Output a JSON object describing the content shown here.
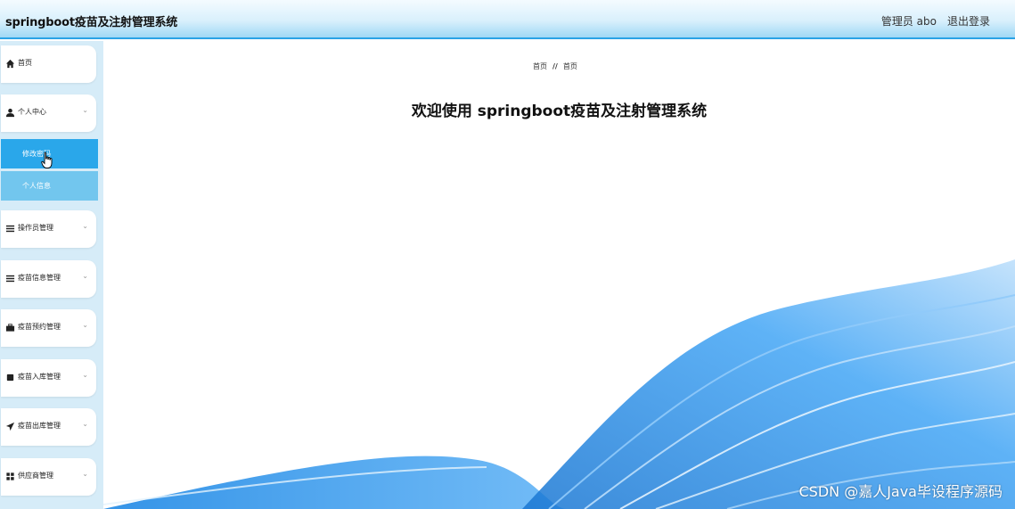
{
  "header": {
    "app_title": "springboot疫苗及注射管理系统",
    "user_info": "管理员 abo",
    "logout_label": "退出登录"
  },
  "sidebar": {
    "home_label": "首页",
    "personal_center_label": "个人中心",
    "change_password_label": "修改密码",
    "personal_info_label": "个人信息",
    "operator_mgmt_label": "操作员管理",
    "vaccine_info_label": "疫苗信息管理",
    "vaccine_appt_label": "疫苗预约管理",
    "vaccine_in_label": "疫苗入库管理",
    "vaccine_out_label": "疫苗出库管理",
    "supplier_label": "供应商管理",
    "chevron": "⌄"
  },
  "breadcrumb": {
    "home": "首页",
    "separator": "//",
    "current": "首页"
  },
  "main": {
    "welcome": "欢迎使用 springboot疫苗及注射管理系统"
  },
  "watermark": "CSDN @嘉人Java毕设程序源码",
  "colors": {
    "accent": "#2aa7ea",
    "submenu_light": "#72c6ee",
    "sidebar_bg": "#d6ecf8"
  }
}
